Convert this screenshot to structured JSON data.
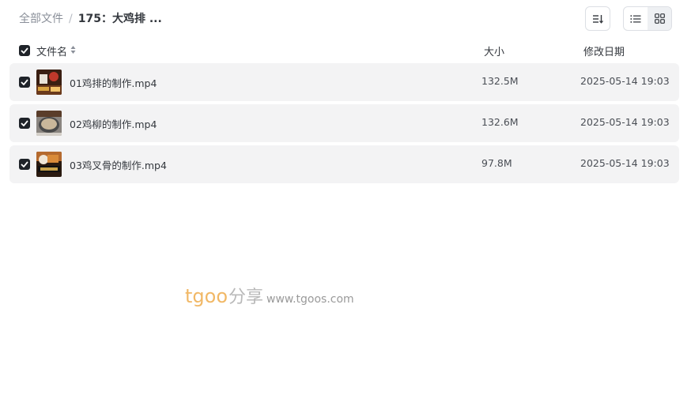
{
  "breadcrumb": {
    "root": "全部文件",
    "separator": "/",
    "current": "175：大鸡排 ..."
  },
  "toolbar": {
    "sort_icon": "sort-descending-icon",
    "list_view_icon": "list-view-icon",
    "grid_view_icon": "grid-view-icon"
  },
  "columns": {
    "name": "文件名",
    "size": "大小",
    "date": "修改日期"
  },
  "files": [
    {
      "name": "01鸡排的制作.mp4",
      "size": "132.5M",
      "modified": "2025-05-14 19:03",
      "checked": true,
      "thumb_icon": "video-thumbnail-icon"
    },
    {
      "name": "02鸡柳的制作.mp4",
      "size": "132.6M",
      "modified": "2025-05-14 19:03",
      "checked": true,
      "thumb_icon": "video-thumbnail-icon"
    },
    {
      "name": "03鸡叉骨的制作.mp4",
      "size": "97.8M",
      "modified": "2025-05-14 19:03",
      "checked": true,
      "thumb_icon": "video-thumbnail-icon"
    }
  ],
  "watermark": {
    "brand": "tgoo",
    "cn": "分享",
    "url": "www.tgoos.com"
  },
  "colors": {
    "row_bg": "#f3f3f4",
    "checkbox": "#1f2329",
    "watermark_brand": "#f1b866"
  }
}
